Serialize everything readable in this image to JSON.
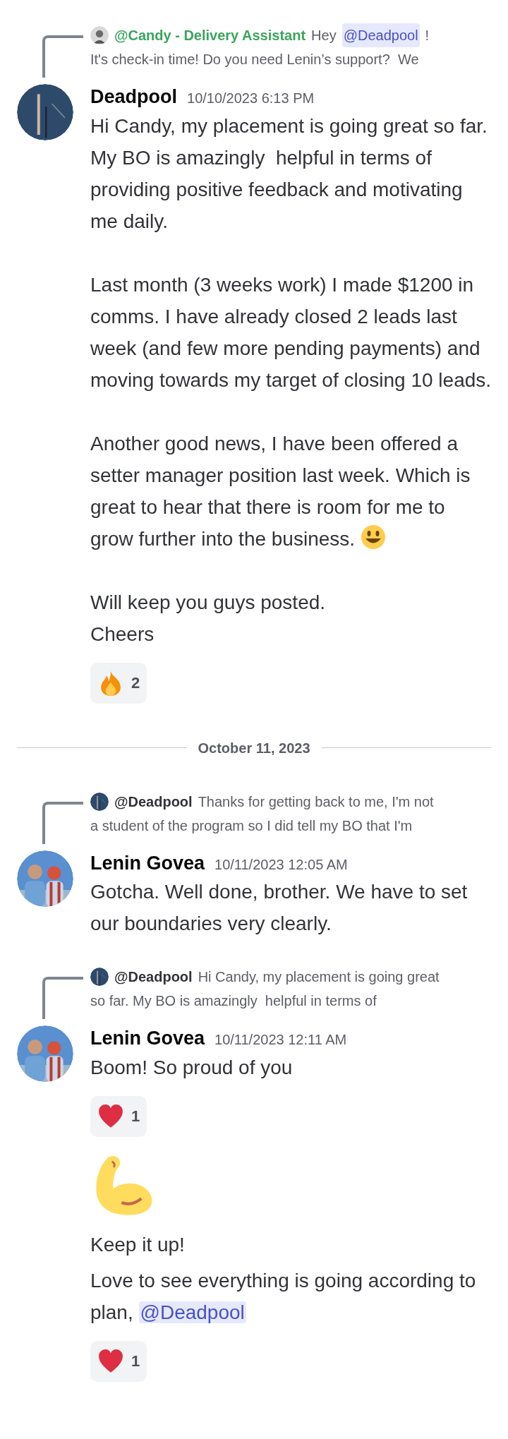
{
  "messages": [
    {
      "reply": {
        "avatar": {
          "kind": "candy"
        },
        "author": "@Candy - Delivery Assistant",
        "color": "#3ba55c",
        "lines": [
          [
            {
              "kind": "text",
              "text": "Hey"
            },
            {
              "kind": "mention",
              "text": "@Deadpool"
            },
            {
              "kind": "text",
              "text": "!"
            }
          ],
          [
            {
              "kind": "text",
              "text": "It's check-in time! Do you need Lenin’s support?  We"
            }
          ]
        ]
      },
      "avatar": {
        "kind": "deadpool"
      },
      "author": "Deadpool",
      "timestamp": "10/10/2023 6:13 PM",
      "parts": [
        {
          "kind": "text",
          "paragraphs": [
            [
              {
                "kind": "text",
                "text": "Hi Candy, my placement is going great so far. My BO is amazingly  helpful in terms of providing positive feedback and motivating me daily."
              }
            ],
            [
              {
                "kind": "text",
                "text": "Last month (3 weeks work) I made $1200 in comms. I have already closed 2 leads last week (and few more pending payments) and moving towards my target of closing 10 leads."
              }
            ],
            [
              {
                "kind": "text",
                "text": "Another good news, I have been offered a setter manager position last week. Which is great to hear that there is room for me to grow further into the business. "
              },
              {
                "kind": "smiley_emoji"
              }
            ],
            [
              {
                "kind": "text",
                "text": "Will keep you guys posted.\nCheers"
              }
            ]
          ]
        },
        {
          "kind": "reaction",
          "emoji": {
            "kind": "fire"
          },
          "count": "2"
        }
      ]
    },
    {
      "kind": "divider",
      "label": "October 11, 2023"
    },
    {
      "reply": {
        "avatar": {
          "kind": "deadpool"
        },
        "author": "@Deadpool",
        "color": "#313338",
        "lines": [
          [
            {
              "kind": "text",
              "text": "Thanks for getting back to me, I'm not"
            }
          ],
          [
            {
              "kind": "text",
              "text": "a student of the program so I did tell my BO that I'm"
            }
          ]
        ]
      },
      "avatar": {
        "kind": "lenin"
      },
      "author": "Lenin Govea",
      "timestamp": "10/11/2023 12:05 AM",
      "parts": [
        {
          "kind": "text",
          "paragraphs": [
            [
              {
                "kind": "text",
                "text": "Gotcha. Well done, brother. We have to set our boundaries very clearly."
              }
            ]
          ]
        }
      ]
    },
    {
      "reply": {
        "avatar": {
          "kind": "deadpool"
        },
        "author": "@Deadpool",
        "color": "#313338",
        "lines": [
          [
            {
              "kind": "text",
              "text": "Hi Candy, my placement is going great"
            }
          ],
          [
            {
              "kind": "text",
              "text": "so far. My BO is amazingly  helpful in terms of"
            }
          ]
        ]
      },
      "avatar": {
        "kind": "lenin"
      },
      "author": "Lenin Govea",
      "timestamp": "10/11/2023 12:11 AM",
      "parts": [
        {
          "kind": "text",
          "paragraphs": [
            [
              {
                "kind": "text",
                "text": "Boom! So proud of you"
              }
            ]
          ]
        },
        {
          "kind": "reaction",
          "emoji": {
            "kind": "heart"
          },
          "count": "1"
        },
        {
          "kind": "jumbo",
          "emoji": {
            "kind": "muscle"
          }
        },
        {
          "kind": "text",
          "paragraphs": [
            [
              {
                "kind": "text",
                "text": "Keep it up!"
              }
            ]
          ]
        },
        {
          "kind": "text",
          "paragraphs": [
            [
              {
                "kind": "text",
                "text": "Love to see everything is going according to plan, "
              },
              {
                "kind": "mention",
                "text": "@Deadpool"
              }
            ]
          ]
        },
        {
          "kind": "reaction",
          "emoji": {
            "kind": "heart"
          },
          "count": "1"
        }
      ]
    }
  ]
}
